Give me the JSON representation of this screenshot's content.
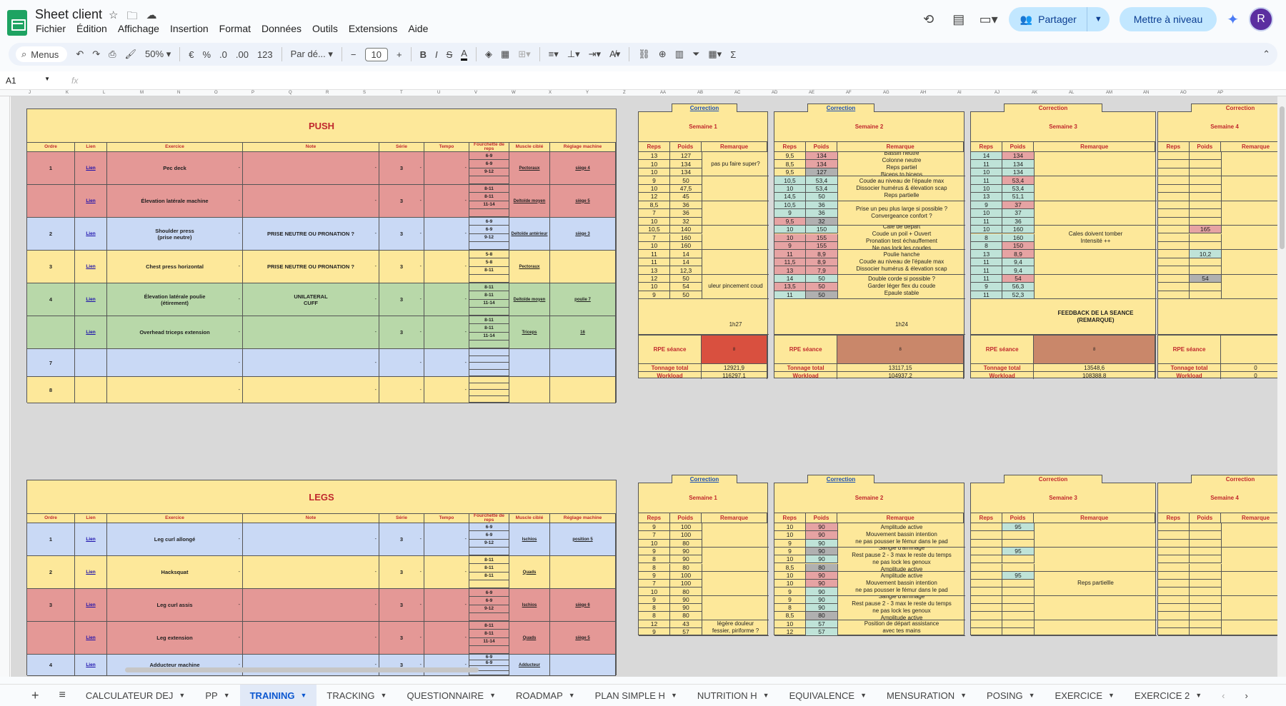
{
  "header": {
    "doc_title": "Sheet client",
    "menu": [
      "Fichier",
      "Édition",
      "Affichage",
      "Insertion",
      "Format",
      "Données",
      "Outils",
      "Extensions",
      "Aide"
    ],
    "share_label": "Partager",
    "upgrade_label": "Mettre à niveau",
    "avatar_letter": "R"
  },
  "toolbar": {
    "search": "Menus",
    "zoom": "50%",
    "currency": "€",
    "percent": "%",
    "dec_minus": ".0",
    "dec_plus": ".00",
    "numfmt": "123",
    "font": "Par dé...",
    "font_size": "10"
  },
  "formula": {
    "cell_ref": "A1",
    "fx": "fx"
  },
  "col_letters": [
    "J",
    "K",
    "L",
    "M",
    "N",
    "O",
    "P",
    "Q",
    "R",
    "S",
    "T",
    "U",
    "V",
    "W",
    "X",
    "Y",
    "Z",
    "AA",
    "AB",
    "AC",
    "AD",
    "AE",
    "AF",
    "AG",
    "AH",
    "AI",
    "AJ",
    "AK",
    "AL",
    "AM",
    "AN",
    "AO",
    "AP"
  ],
  "program_headers": [
    "Ordre",
    "Lien",
    "Exercice",
    "Note",
    "Série",
    "Tempo",
    "Fourchette de reps",
    "Muscle ciblé",
    "Réglage machine"
  ],
  "push": {
    "title": "PUSH",
    "rows": [
      {
        "ordre": "1",
        "lien": "Lien",
        "exercice": "Pec deck",
        "note": "",
        "serie": "3",
        "reps": [
          "6-9",
          "6-9",
          "9-12",
          ""
        ],
        "muscle": "Pectoraux",
        "reglage": "siège 4",
        "color": "red"
      },
      {
        "ordre": "",
        "lien": "Lien",
        "exercice": "Élevation latérale machine",
        "note": "",
        "serie": "3",
        "reps": [
          "8-11",
          "8-11",
          "11-14",
          ""
        ],
        "muscle": "Deltoïde moyen",
        "reglage": "siège 5",
        "color": "red"
      },
      {
        "ordre": "2",
        "lien": "Lien",
        "exercice": "Shoulder press\n(prise neutre)",
        "note": "PRISE NEUTRE OU PRONATION ?",
        "serie": "3",
        "reps": [
          "6-9",
          "6-9",
          "9-12",
          ""
        ],
        "muscle": "Deltoïde antérieur",
        "reglage": "siège 3",
        "color": "blue"
      },
      {
        "ordre": "3",
        "lien": "Lien",
        "exercice": "Chest press horizontal",
        "note": "PRISE NEUTRE OU PRONATION ?",
        "serie": "3",
        "reps": [
          "5-8",
          "5-8",
          "8-11",
          ""
        ],
        "muscle": "Pectoraux",
        "reglage": "",
        "color": "yel"
      },
      {
        "ordre": "4",
        "lien": "Lien",
        "exercice": "Élevation latérale poulie\n(étirement)",
        "note": "UNILATERAL\nCUFF",
        "serie": "3",
        "reps": [
          "8-11",
          "8-11",
          "11-14",
          ""
        ],
        "muscle": "Deltoïde moyen",
        "reglage": "poulie 7",
        "color": "green"
      },
      {
        "ordre": "",
        "lien": "Lien",
        "exercice": "Overhead triceps extension",
        "note": "",
        "serie": "3",
        "reps": [
          "8-11",
          "8-11",
          "11-14",
          ""
        ],
        "muscle": "Triceps",
        "reglage": "16",
        "color": "green"
      },
      {
        "ordre": "7",
        "lien": "",
        "exercice": "",
        "note": "",
        "serie": "",
        "reps": [
          "",
          "",
          "",
          ""
        ],
        "muscle": "",
        "reglage": "",
        "color": "blue"
      },
      {
        "ordre": "8",
        "lien": "",
        "exercice": "",
        "note": "",
        "serie": "",
        "reps": [
          "",
          "",
          "",
          ""
        ],
        "muscle": "",
        "reglage": "",
        "color": "yel"
      }
    ]
  },
  "legs": {
    "title": "LEGS",
    "rows": [
      {
        "ordre": "1",
        "lien": "Lien",
        "exercice": "Leg curl allongé",
        "note": "",
        "serie": "3",
        "reps": [
          "6-9",
          "6-9",
          "9-12",
          ""
        ],
        "muscle": "Ischios",
        "reglage": "position 5",
        "color": "blue"
      },
      {
        "ordre": "2",
        "lien": "Lien",
        "exercice": "Hacksquat",
        "note": "",
        "serie": "3",
        "reps": [
          "8-11",
          "8-11",
          "8-11",
          ""
        ],
        "muscle": "Quads",
        "reglage": "",
        "color": "yel"
      },
      {
        "ordre": "3",
        "lien": "Lien",
        "exercice": "Leg curl assis",
        "note": "",
        "serie": "3",
        "reps": [
          "6-9",
          "6-9",
          "9-12",
          ""
        ],
        "muscle": "Ischios",
        "reglage": "siège 6",
        "color": "red"
      },
      {
        "ordre": "",
        "lien": "Lien",
        "exercice": "Leg extension",
        "note": "",
        "serie": "3",
        "reps": [
          "8-11",
          "8-11",
          "11-14",
          ""
        ],
        "muscle": "Quads",
        "reglage": "siège 5",
        "color": "red"
      },
      {
        "ordre": "4",
        "lien": "Lien",
        "exercice": "Adducteur machine",
        "note": "",
        "serie": "3",
        "reps": [
          "6-9",
          "6-9",
          "",
          ""
        ],
        "muscle": "Adducteur",
        "reglage": "",
        "color": "blue"
      }
    ]
  },
  "week_headers": [
    "Reps",
    "Poids",
    "Remarque"
  ],
  "week_footer": {
    "rpe": "RPE séance",
    "tonnage": "Tonnage total",
    "workload": "Workload"
  },
  "push_weeks": [
    {
      "correction": "Correction",
      "title": "Semaine 1",
      "rows": [
        [
          "13",
          "127"
        ],
        [
          "10",
          "134"
        ],
        [
          "10",
          "134"
        ],
        [
          "9",
          "50"
        ],
        [
          "10",
          "47,5"
        ],
        [
          "12",
          "45"
        ],
        [
          "8,5",
          "36"
        ],
        [
          "7",
          "36"
        ],
        [
          "10",
          "32"
        ],
        [
          "10,5",
          "140"
        ],
        [
          "7",
          "160"
        ],
        [
          "10",
          "160"
        ],
        [
          "11",
          "14"
        ],
        [
          "11",
          "14"
        ],
        [
          "13",
          "12,3"
        ],
        [
          "12",
          "50"
        ],
        [
          "10",
          "54"
        ],
        [
          "9",
          "50"
        ]
      ],
      "remarks": [
        "pas pu faire super?",
        "",
        "",
        "",
        "",
        "uleur pincement coud"
      ],
      "duration": "1h27",
      "rpe": "8",
      "tonnage": "12921,9",
      "workload": "116297,1"
    },
    {
      "correction": "Correction",
      "title": "Semaine 2",
      "rows": [
        [
          "9,5",
          "134"
        ],
        [
          "8,5",
          "134"
        ],
        [
          "9,5",
          "127"
        ],
        [
          "10,5",
          "53,4"
        ],
        [
          "10",
          "53,4"
        ],
        [
          "14,5",
          "50"
        ],
        [
          "10,5",
          "36"
        ],
        [
          "9",
          "36"
        ],
        [
          "9,5",
          "32"
        ],
        [
          "10",
          "150"
        ],
        [
          "10",
          "155"
        ],
        [
          "9",
          "155"
        ],
        [
          "11",
          "8,9"
        ],
        [
          "11,5",
          "8,9"
        ],
        [
          "13",
          "7,9"
        ],
        [
          "14",
          "50"
        ],
        [
          "13,5",
          "50"
        ],
        [
          "11",
          "50"
        ]
      ],
      "remarks": [
        "Bassin neutre\nColonne neutre\nReps partiel\nBiceps to biceps",
        "Coude au niveau de l'épaule  max\nDissocier humérus & élevation scap\nReps partielle",
        "Prise un peu plus large si possible ?\nConvergeance confort ?",
        "Cale de départ\nCoude un poil + Ouvert\nPronation test échauffement\nNe pas lock les coudes",
        "Poulie hanche\nCoude au niveau de l'épaule  max\nDissocier humérus & élevation scap",
        "Double corde si possible ?\nGarder léger flex du coude\nEpaule stable"
      ],
      "duration": "1h24",
      "rpe": "8",
      "tonnage": "13117,15",
      "workload": "104937,2"
    },
    {
      "correction": "Correction",
      "title": "Semaine 3",
      "rows": [
        [
          "14",
          "134"
        ],
        [
          "11",
          "134"
        ],
        [
          "10",
          "134"
        ],
        [
          "11",
          "53,4"
        ],
        [
          "10",
          "53,4"
        ],
        [
          "13",
          "51,1"
        ],
        [
          "9",
          "37"
        ],
        [
          "10",
          "37"
        ],
        [
          "11",
          "36"
        ],
        [
          "10",
          "160"
        ],
        [
          "8",
          "160"
        ],
        [
          "8",
          "150"
        ],
        [
          "13",
          "8,9"
        ],
        [
          "11",
          "9,4"
        ],
        [
          "11",
          "9,4"
        ],
        [
          "11",
          "54"
        ],
        [
          "9",
          "56,3"
        ],
        [
          "11",
          "52,3"
        ]
      ],
      "remarks": [
        "",
        "",
        "",
        "Cales doivent tomber\nIntensité ++",
        "",
        ""
      ],
      "feedback": "FEEDBACK DE LA SEANCE\n(REMARQUE)",
      "rpe": "8",
      "tonnage": "13548,6",
      "workload": "108388,8"
    },
    {
      "correction": "Correction",
      "title": "Semaine 4",
      "rows": [
        [
          "",
          ""
        ],
        [
          "",
          ""
        ],
        [
          "",
          ""
        ],
        [
          "",
          ""
        ],
        [
          "",
          ""
        ],
        [
          "",
          ""
        ],
        [
          "",
          ""
        ],
        [
          "",
          ""
        ],
        [
          "",
          ""
        ],
        [
          "",
          "165"
        ],
        [
          "",
          ""
        ],
        [
          "",
          ""
        ],
        [
          "",
          "10,2"
        ],
        [
          "",
          ""
        ],
        [
          "",
          ""
        ],
        [
          "",
          "54"
        ],
        [
          "",
          ""
        ],
        [
          "",
          ""
        ]
      ],
      "remarks": [
        "",
        "",
        "",
        "",
        "",
        ""
      ],
      "rpe": "",
      "tonnage": "0",
      "workload": "0"
    }
  ],
  "legs_weeks": [
    {
      "correction": "Correction",
      "title": "Semaine 1",
      "rows": [
        [
          "9",
          "100"
        ],
        [
          "7",
          "100"
        ],
        [
          "10",
          "80"
        ],
        [
          "9",
          "90"
        ],
        [
          "8",
          "90"
        ],
        [
          "8",
          "80"
        ],
        [
          "9",
          "100"
        ],
        [
          "7",
          "100"
        ],
        [
          "10",
          "80"
        ],
        [
          "9",
          "90"
        ],
        [
          "8",
          "90"
        ],
        [
          "8",
          "80"
        ],
        [
          "12",
          "43"
        ],
        [
          "9",
          "57"
        ]
      ],
      "remarks": [
        "",
        "",
        "",
        "",
        "légère  douleur\nfessier, piriforme ?"
      ]
    },
    {
      "correction": "Correction",
      "title": "Semaine 2",
      "rows": [
        [
          "10",
          "90"
        ],
        [
          "10",
          "90"
        ],
        [
          "9",
          "90"
        ],
        [
          "9",
          "90"
        ],
        [
          "10",
          "90"
        ],
        [
          "8,5",
          "80"
        ],
        [
          "10",
          "90"
        ],
        [
          "10",
          "90"
        ],
        [
          "9",
          "90"
        ],
        [
          "9",
          "90"
        ],
        [
          "8",
          "90"
        ],
        [
          "8,5",
          "80"
        ],
        [
          "10",
          "57"
        ],
        [
          "12",
          "57"
        ]
      ],
      "remarks": [
        "Amplitude active\nMouvement bassin intention\nne pas pousser le fémur dans le pad",
        "Sangle d'arrimage\nRest pause 2 - 3 max le reste du temps\nne pas lock les genoux\nAmplitude active",
        "Amplitude active\nMouvement bassin intention\nne pas pousser le fémur dans le pad",
        "Sangle d'arrimage\nRest pause 2 - 3 max le reste du temps\nne pas lock les genoux\nAmplitude active",
        "Position de départ assistance\navec tes mains"
      ]
    },
    {
      "correction": "Correction",
      "title": "Semaine 3",
      "rows": [
        [
          "",
          "95"
        ],
        [
          "",
          ""
        ],
        [
          "",
          ""
        ],
        [
          "",
          "95"
        ],
        [
          "",
          ""
        ],
        [
          "",
          ""
        ],
        [
          "",
          "95"
        ],
        [
          "",
          ""
        ],
        [
          "",
          ""
        ],
        [
          "",
          ""
        ],
        [
          "",
          ""
        ],
        [
          "",
          ""
        ],
        [
          "",
          ""
        ],
        [
          "",
          ""
        ]
      ],
      "remarks": [
        "",
        "",
        "Reps partiellle",
        "",
        ""
      ]
    },
    {
      "correction": "Correction",
      "title": "Semaine 4",
      "rows": [
        [
          "",
          ""
        ],
        [
          "",
          ""
        ],
        [
          "",
          ""
        ],
        [
          "",
          ""
        ],
        [
          "",
          ""
        ],
        [
          "",
          ""
        ],
        [
          "",
          ""
        ],
        [
          "",
          ""
        ],
        [
          "",
          ""
        ],
        [
          "",
          ""
        ],
        [
          "",
          ""
        ],
        [
          "",
          ""
        ],
        [
          "",
          ""
        ],
        [
          "",
          ""
        ]
      ],
      "remarks": [
        "",
        "",
        "",
        "",
        ""
      ]
    }
  ],
  "tabs": [
    "CALCULATEUR DEJ",
    "PP",
    "TRAINING",
    "TRACKING",
    "QUESTIONNAIRE",
    "ROADMAP",
    "PLAN SIMPLE H",
    "NUTRITION H",
    "EQUIVALENCE",
    "MENSURATION",
    "POSING",
    "EXERCICE",
    "EXERCICE 2"
  ],
  "active_tab": "TRAINING"
}
